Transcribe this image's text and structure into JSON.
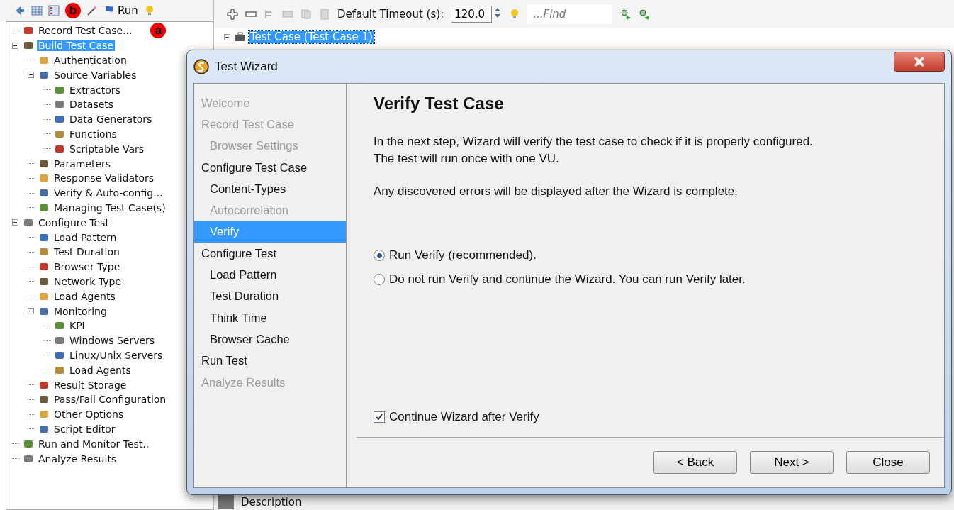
{
  "left_toolbar": {
    "badge": "b",
    "run_label": "Run"
  },
  "tree": {
    "badge": "a",
    "items": [
      {
        "label": "Record Test Case...",
        "selected": false
      },
      {
        "label": "Build Test Case",
        "selected": true,
        "expanded": true,
        "children": [
          {
            "label": "Authentication",
            "selected": false
          },
          {
            "label": "Source Variables",
            "selected": false,
            "expanded": true,
            "children": [
              {
                "label": "Extractors",
                "selected": false
              },
              {
                "label": "Datasets",
                "selected": false
              },
              {
                "label": "Data Generators",
                "selected": false
              },
              {
                "label": "Functions",
                "selected": false
              },
              {
                "label": "Scriptable Vars",
                "selected": false
              }
            ]
          },
          {
            "label": "Parameters",
            "selected": false
          },
          {
            "label": "Response Validators",
            "selected": false
          },
          {
            "label": "Verify & Auto-config...",
            "selected": false
          },
          {
            "label": "Managing Test Case(s)",
            "selected": false
          }
        ]
      },
      {
        "label": "Configure Test",
        "selected": false,
        "expanded": true,
        "children": [
          {
            "label": "Load Pattern",
            "selected": false
          },
          {
            "label": "Test Duration",
            "selected": false
          },
          {
            "label": "Browser Type",
            "selected": false
          },
          {
            "label": "Network Type",
            "selected": false
          },
          {
            "label": "Load Agents",
            "selected": false
          },
          {
            "label": "Monitoring",
            "selected": false,
            "expanded": true,
            "children": [
              {
                "label": "KPI",
                "selected": false
              },
              {
                "label": "Windows Servers",
                "selected": false
              },
              {
                "label": "Linux/Unix Servers",
                "selected": false
              },
              {
                "label": "Load Agents",
                "selected": false
              }
            ]
          },
          {
            "label": "Result Storage",
            "selected": false
          },
          {
            "label": "Pass/Fail Configuration",
            "selected": false
          },
          {
            "label": "Other Options",
            "selected": false
          },
          {
            "label": "Script Editor",
            "selected": false
          }
        ]
      },
      {
        "label": "Run and Monitor Test..",
        "selected": false
      },
      {
        "label": "Analyze Results",
        "selected": false
      }
    ]
  },
  "right_toolbar": {
    "timeout_label": "Default Timeout (s):",
    "timeout_value": "120.0",
    "find_placeholder": "...Find"
  },
  "test_tree": {
    "label": "Test Case (Test Case 1)",
    "selected": true,
    "expanded": true
  },
  "bottom_header": "Description",
  "wizard": {
    "title": "Test Wizard",
    "steps": [
      {
        "label": "Welcome",
        "disabled": true,
        "selected": false
      },
      {
        "label": "Record Test Case",
        "disabled": true,
        "selected": false,
        "children": [
          {
            "label": "Browser Settings",
            "disabled": true,
            "selected": false
          }
        ]
      },
      {
        "label": "Configure Test Case",
        "disabled": false,
        "selected": false,
        "children": [
          {
            "label": "Content-Types",
            "disabled": false,
            "selected": false
          },
          {
            "label": "Autocorrelation",
            "disabled": true,
            "selected": false
          },
          {
            "label": "Verify",
            "disabled": false,
            "selected": true
          }
        ]
      },
      {
        "label": "Configure Test",
        "disabled": false,
        "selected": false,
        "children": [
          {
            "label": "Load Pattern",
            "disabled": false,
            "selected": false
          },
          {
            "label": "Test Duration",
            "disabled": false,
            "selected": false
          },
          {
            "label": "Think Time",
            "disabled": false,
            "selected": false
          },
          {
            "label": "Browser Cache",
            "disabled": false,
            "selected": false
          }
        ]
      },
      {
        "label": "Run Test",
        "disabled": false,
        "selected": false
      },
      {
        "label": "Analyze Results",
        "disabled": true,
        "selected": false
      }
    ],
    "heading": "Verify Test Case",
    "paragraphs": [
      "In the next step, Wizard will verify the test case to check if it is properly configured.\nThe test will run once with one VU.",
      "Any discovered errors will be displayed after the Wizard is complete."
    ],
    "options": [
      {
        "label": "Run Verify (recommended).",
        "selected": true
      },
      {
        "label": "Do not run Verify and continue the Wizard. You can run Verify later.",
        "selected": false
      }
    ],
    "continue_checkbox": {
      "label": "Continue Wizard after Verify",
      "checked": true
    },
    "buttons": [
      "< Back",
      "Next >",
      "Close"
    ]
  }
}
